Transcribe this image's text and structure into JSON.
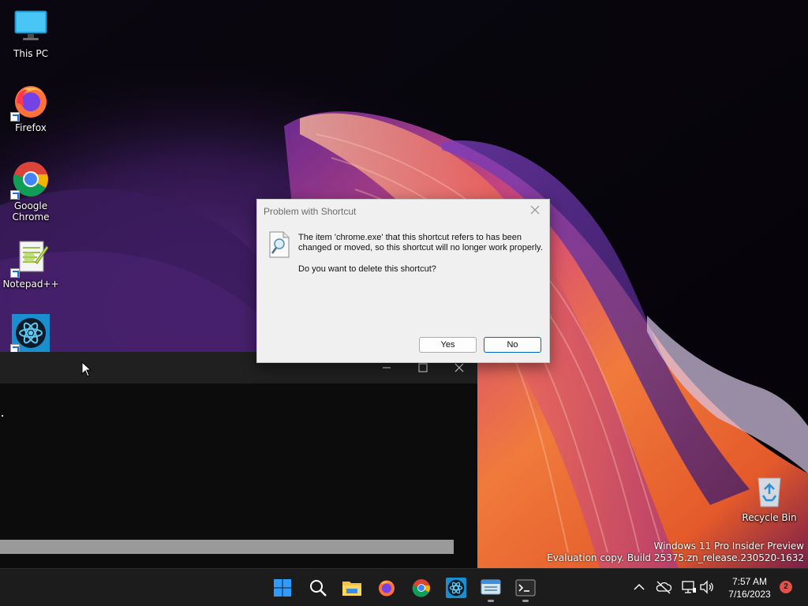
{
  "desktop": {
    "icons": [
      {
        "label": "This PC",
        "icon": "monitor-icon"
      },
      {
        "label": "Firefox",
        "icon": "firefox-icon"
      },
      {
        "label": "Google Chrome",
        "icon": "chrome-icon"
      },
      {
        "label": "Notepad++",
        "icon": "notepadpp-icon"
      },
      {
        "label": "",
        "icon": "electron-app-icon"
      },
      {
        "label": "Recycle Bin",
        "icon": "recycle-bin-icon"
      }
    ],
    "watermark": {
      "line1": "Windows 11 Pro Insider Preview",
      "line2": "Evaluation copy. Build 25375.zn_release.230520-1632"
    }
  },
  "dialog": {
    "title": "Problem with Shortcut",
    "message": "The item 'chrome.exe' that this shortcut refers to has been changed or moved, so this shortcut will no longer work properly.",
    "question": "Do you want to delete this shortcut?",
    "yes_label": "Yes",
    "no_label": "No"
  },
  "terminal": {
    "title": "",
    "controls": [
      "minimize-icon",
      "maximize-icon",
      "close-icon"
    ]
  },
  "taskbar": {
    "apps": [
      "start-icon",
      "search-icon",
      "file-explorer-icon",
      "firefox-icon",
      "chrome-icon",
      "electron-app-icon",
      "keyboard-app-icon",
      "terminal-icon"
    ],
    "tray": [
      "chevron-up-icon",
      "cloud-offline-icon",
      "network-icon",
      "volume-icon"
    ],
    "time": "7:57 AM",
    "date": "7/16/2023",
    "notification_count": "2"
  },
  "colors": {
    "accent": "#0067c0",
    "taskbar": "#1c1c1c",
    "dialog_bg": "#f0f0f0",
    "terminal_bg": "#0c0c0c"
  }
}
